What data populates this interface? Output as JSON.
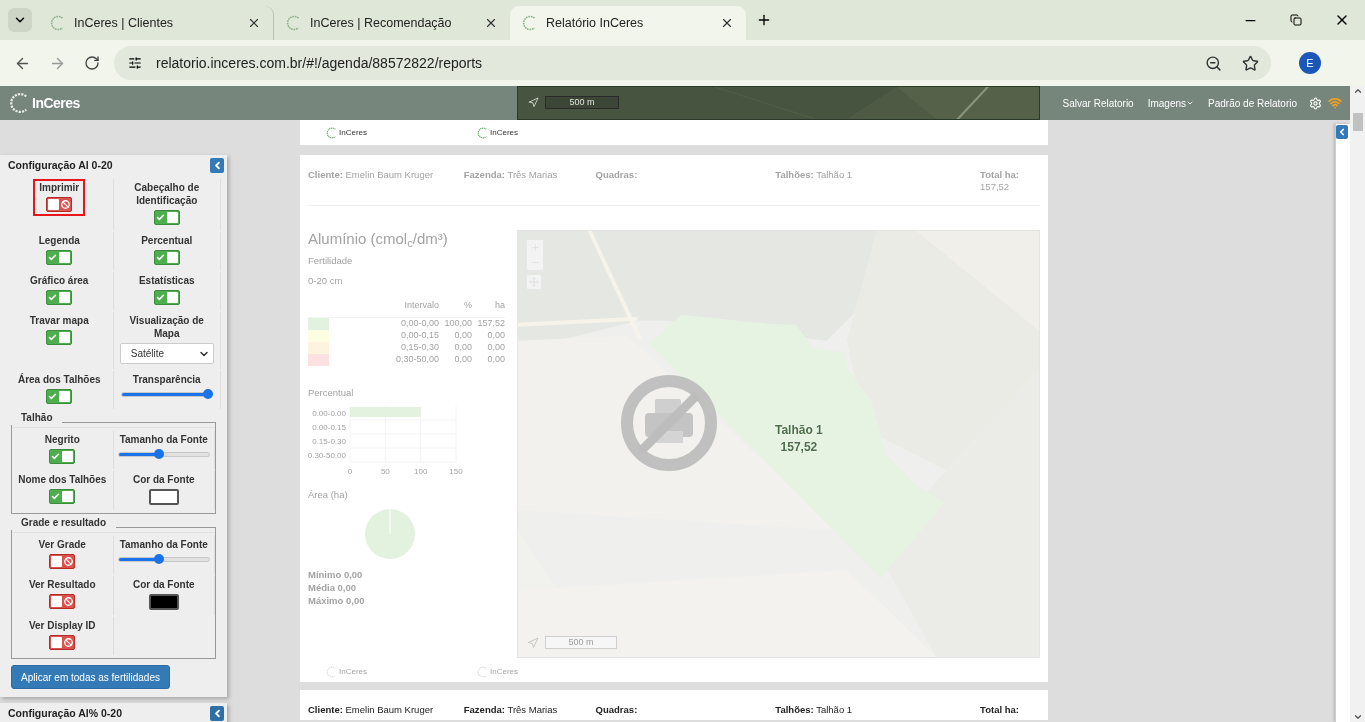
{
  "browser": {
    "tabs": [
      {
        "title": "InCeres | Clientes",
        "selected": false
      },
      {
        "title": "InCeres | Recomendação",
        "selected": false
      },
      {
        "title": "Relatório InCeres",
        "selected": true
      }
    ],
    "address": "relatorio.inceres.com.br/#!/agenda/88572822/reports",
    "profile": "E"
  },
  "app_bar": {
    "logo": "InCeres",
    "map_scale": "500 m",
    "menu": [
      {
        "label": "Salvar Relatorio",
        "dropdown": false
      },
      {
        "label": "Imagens",
        "dropdown": true
      },
      {
        "label": "Padrão de Relatorio",
        "dropdown": false
      }
    ]
  },
  "config_panels": [
    {
      "title": "Configuração Al 0-20",
      "expanded": true,
      "groups": [
        {
          "kind": "plain",
          "items": [
            {
              "kind": "toggle",
              "label": "Imprimir",
              "on": false,
              "focused": true
            },
            {
              "kind": "toggle",
              "label": "Cabeçalho de Identificação",
              "on": true,
              "focused": false
            },
            {
              "kind": "toggle",
              "label": "Legenda",
              "on": true,
              "focused": false
            },
            {
              "kind": "toggle",
              "label": "Percentual",
              "on": true,
              "focused": false
            },
            {
              "kind": "toggle",
              "label": "Gráfico área",
              "on": true,
              "focused": false
            },
            {
              "kind": "toggle",
              "label": "Estatísticas",
              "on": true,
              "focused": false
            },
            {
              "kind": "toggle",
              "label": "Travar mapa",
              "on": true,
              "focused": false
            },
            {
              "kind": "select",
              "label": "Visualização de Mapa",
              "value": "Satélite",
              "focused": false
            },
            {
              "kind": "toggle",
              "label": "Área dos Talhões",
              "on": true,
              "focused": false
            },
            {
              "kind": "slider",
              "label": "Transparência",
              "level": 0.95,
              "focused": false
            }
          ]
        },
        {
          "kind": "fieldset",
          "title": "Talhão",
          "items": [
            {
              "kind": "toggle",
              "label": "Negrito",
              "on": true,
              "focused": false
            },
            {
              "kind": "slider",
              "label": "Tamanho da Fonte",
              "level": 0.45,
              "focused": false
            },
            {
              "kind": "toggle",
              "label": "Nome dos Talhões",
              "on": true,
              "focused": false
            },
            {
              "kind": "color",
              "label": "Cor da Fonte",
              "color": "#ffffff",
              "focused": false
            }
          ]
        },
        {
          "kind": "fieldset",
          "title": "Grade e resultado",
          "items": [
            {
              "kind": "toggle",
              "label": "Ver Grade",
              "on": false,
              "focused": false
            },
            {
              "kind": "slider",
              "label": "Tamanho da Fonte",
              "level": 0.45,
              "focused": false
            },
            {
              "kind": "toggle",
              "label": "Ver Resultado",
              "on": false,
              "focused": false
            },
            {
              "kind": "color",
              "label": "Cor da Fonte",
              "color": "#000000",
              "focused": false
            },
            {
              "kind": "toggle",
              "label": "Ver Display ID",
              "on": false,
              "focused": false
            }
          ]
        }
      ],
      "button": "Aplicar em todas as fertilidades"
    },
    {
      "title": "Configuração Al% 0-20",
      "expanded": false
    }
  ],
  "report": {
    "sheet_logos": [
      "InCeres",
      "InCeres"
    ],
    "cards": [
      {
        "faded": true,
        "header": [
          {
            "label": "Cliente:",
            "value": "Emelin Baum Kruger"
          },
          {
            "label": "Fazenda:",
            "value": "Três Marias"
          },
          {
            "label": "Quadras:"
          },
          {
            "label": "Talhões:",
            "value": "Talhão 1"
          },
          {
            "label": "Total ha:",
            "value": "157,52"
          }
        ],
        "title": "Alumínio (cmol$_{c}$/dm³)",
        "subtitles": [
          "Fertilidade",
          "0-20 cm"
        ],
        "legend": {
          "columns": [
            "Intervalo",
            "%",
            "ha"
          ],
          "rows": [
            {
              "color": "#e3f1df",
              "cells": [
                "0,00-0,00",
                "100,00",
                "157,52"
              ]
            },
            {
              "color": "#fdfde1",
              "cells": [
                "0,00-0,15",
                "0,00",
                "0,00"
              ]
            },
            {
              "color": "#fdf3df",
              "cells": [
                "0,15-0,30",
                "0,00",
                "0,00"
              ]
            },
            {
              "color": "#fbe1e1",
              "cells": [
                "0,30-50,00",
                "0,00",
                "0,00"
              ]
            }
          ]
        },
        "percent_chart": {
          "title": "Percentual",
          "chart_data": {
            "type": "bar",
            "orientation": "horizontal",
            "categories": [
              "0.00-0.00",
              "0.00-0.15",
              "0.15-0.30",
              "0.30-50.00"
            ],
            "values": [
              100,
              0,
              0,
              0
            ],
            "xlim": [
              0,
              150
            ],
            "xticks": [
              0,
              50,
              100,
              150
            ]
          }
        },
        "area_chart": {
          "title": "Área (ha)"
        },
        "stats": [
          "Mínimo 0,00",
          "Média 0,00",
          "Máximo 0,00"
        ],
        "map": {
          "field_name": "Talhão 1",
          "field_area": "157,52",
          "scale": "500 m",
          "print_disabled": true
        },
        "footer_logos": [
          "InCeres",
          "InCeres"
        ]
      },
      {
        "faded": false,
        "header": [
          {
            "label": "Cliente:",
            "value": "Emelin Baum Kruger"
          },
          {
            "label": "Fazenda:",
            "value": "Três Marias"
          },
          {
            "label": "Quadras:"
          },
          {
            "label": "Talhões:",
            "value": "Talhão 1"
          },
          {
            "label": "Total ha:"
          }
        ]
      }
    ]
  }
}
